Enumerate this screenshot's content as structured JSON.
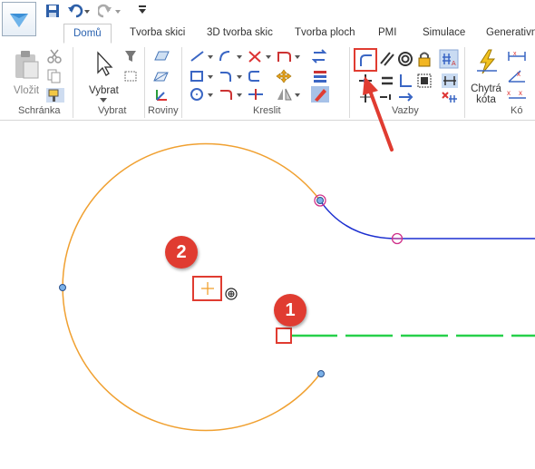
{
  "tabs": [
    "Domů",
    "Tvorba skici",
    "3D tvorba skic",
    "Tvorba ploch",
    "PMI",
    "Simulace",
    "Generativn"
  ],
  "ribbon": {
    "paste_label": "Vložit",
    "select_label": "Vybrat",
    "smart_dim_label": "Chytrá kóta",
    "groups": [
      "Schránka",
      "Vybrat",
      "Roviny",
      "Kreslit",
      "Vazby",
      "Kó"
    ]
  },
  "annotations": {
    "badge1": "1",
    "badge2": "2"
  },
  "colors": {
    "arc": "#f0a030",
    "line_blue": "#1c2fd0",
    "line_green": "#27d04a",
    "accent_red": "#e03c31",
    "active_tab": "#2b63b0"
  }
}
